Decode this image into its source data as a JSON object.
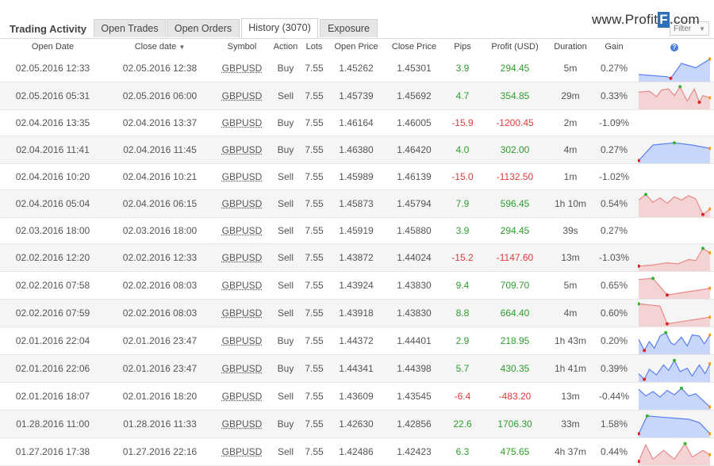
{
  "header": {
    "title": "Trading Activity",
    "tabs": [
      "Open Trades",
      "Open Orders",
      "History (3070)",
      "Exposure"
    ],
    "active_tab": 2,
    "brand_prefix": "www.Profit",
    "brand_f": "F",
    "brand_suffix": ".com",
    "filter_label": "Filter"
  },
  "colors": {
    "positive": "#2e9e2e",
    "negative": "#e23a3a",
    "spark_blue_fill": "#c9d6fb",
    "spark_blue_line": "#5a7ff0",
    "spark_red_fill": "#f3d3d3",
    "spark_red_line": "#e88a8a"
  },
  "columns": [
    "Open Date",
    "Close date",
    "Symbol",
    "Action",
    "Lots",
    "Open Price",
    "Close Price",
    "Pips",
    "Profit (USD)",
    "Duration",
    "Gain",
    "?"
  ],
  "rows": [
    {
      "open": "02.05.2016 12:33",
      "close": "02.05.2016 12:38",
      "symbol": "GBPUSD",
      "action": "Buy",
      "lots": "7.55",
      "open_price": "1.45262",
      "close_price": "1.45301",
      "pips": "3.9",
      "profit": "294.45",
      "duration": "5m",
      "gain": "0.27%",
      "pos": true,
      "spark": {
        "kind": "blue",
        "pts": [
          [
            0,
            0.25
          ],
          [
            0.4,
            0.15
          ],
          [
            0.45,
            0.08
          ],
          [
            0.6,
            0.75
          ],
          [
            0.8,
            0.55
          ],
          [
            1,
            0.95
          ]
        ]
      }
    },
    {
      "open": "02.05.2016 05:31",
      "close": "02.05.2016 06:00",
      "symbol": "GBPUSD",
      "action": "Sell",
      "lots": "7.55",
      "open_price": "1.45739",
      "close_price": "1.45692",
      "pips": "4.7",
      "profit": "354.85",
      "duration": "29m",
      "gain": "0.33%",
      "pos": true,
      "spark": {
        "kind": "red",
        "pts": [
          [
            0,
            0.7
          ],
          [
            0.15,
            0.75
          ],
          [
            0.25,
            0.5
          ],
          [
            0.32,
            0.8
          ],
          [
            0.42,
            0.85
          ],
          [
            0.5,
            0.55
          ],
          [
            0.58,
            0.95
          ],
          [
            0.68,
            0.3
          ],
          [
            0.78,
            0.85
          ],
          [
            0.85,
            0.25
          ],
          [
            0.9,
            0.55
          ],
          [
            1,
            0.45
          ]
        ]
      }
    },
    {
      "open": "02.04.2016 13:35",
      "close": "02.04.2016 13:37",
      "symbol": "GBPUSD",
      "action": "Buy",
      "lots": "7.55",
      "open_price": "1.46164",
      "close_price": "1.46005",
      "pips": "-15.9",
      "profit": "-1200.45",
      "duration": "2m",
      "gain": "-1.09%",
      "pos": false,
      "spark": null
    },
    {
      "open": "02.04.2016 11:41",
      "close": "02.04.2016 11:45",
      "symbol": "GBPUSD",
      "action": "Buy",
      "lots": "7.55",
      "open_price": "1.46380",
      "close_price": "1.46420",
      "pips": "4.0",
      "profit": "302.00",
      "duration": "4m",
      "gain": "0.27%",
      "pos": true,
      "spark": {
        "kind": "blue",
        "pts": [
          [
            0,
            0.05
          ],
          [
            0.2,
            0.75
          ],
          [
            0.5,
            0.85
          ],
          [
            0.75,
            0.75
          ],
          [
            1,
            0.6
          ]
        ]
      }
    },
    {
      "open": "02.04.2016 10:20",
      "close": "02.04.2016 10:21",
      "symbol": "GBPUSD",
      "action": "Sell",
      "lots": "7.55",
      "open_price": "1.45989",
      "close_price": "1.46139",
      "pips": "-15.0",
      "profit": "-1132.50",
      "duration": "1m",
      "gain": "-1.02%",
      "pos": false,
      "spark": null
    },
    {
      "open": "02.04.2016 05:04",
      "close": "02.04.2016 06:15",
      "symbol": "GBPUSD",
      "action": "Sell",
      "lots": "7.55",
      "open_price": "1.45873",
      "close_price": "1.45794",
      "pips": "7.9",
      "profit": "596.45",
      "duration": "1h 10m",
      "gain": "0.54%",
      "pos": true,
      "spark": {
        "kind": "red",
        "pts": [
          [
            0,
            0.7
          ],
          [
            0.1,
            0.95
          ],
          [
            0.2,
            0.6
          ],
          [
            0.3,
            0.8
          ],
          [
            0.4,
            0.55
          ],
          [
            0.5,
            0.85
          ],
          [
            0.6,
            0.7
          ],
          [
            0.7,
            0.9
          ],
          [
            0.8,
            0.75
          ],
          [
            0.9,
            0.05
          ],
          [
            1,
            0.3
          ]
        ]
      }
    },
    {
      "open": "02.03.2016 18:00",
      "close": "02.03.2016 18:00",
      "symbol": "GBPUSD",
      "action": "Sell",
      "lots": "7.55",
      "open_price": "1.45919",
      "close_price": "1.45880",
      "pips": "3.9",
      "profit": "294.45",
      "duration": "39s",
      "gain": "0.27%",
      "pos": true,
      "spark": null
    },
    {
      "open": "02.02.2016 12:20",
      "close": "02.02.2016 12:33",
      "symbol": "GBPUSD",
      "action": "Sell",
      "lots": "7.55",
      "open_price": "1.43872",
      "close_price": "1.44024",
      "pips": "-15.2",
      "profit": "-1147.60",
      "duration": "13m",
      "gain": "-1.03%",
      "pos": false,
      "spark": {
        "kind": "red",
        "pts": [
          [
            0,
            0.15
          ],
          [
            0.2,
            0.2
          ],
          [
            0.4,
            0.3
          ],
          [
            0.55,
            0.25
          ],
          [
            0.7,
            0.45
          ],
          [
            0.8,
            0.4
          ],
          [
            0.9,
            0.95
          ],
          [
            1,
            0.75
          ]
        ]
      }
    },
    {
      "open": "02.02.2016 07:58",
      "close": "02.02.2016 08:03",
      "symbol": "GBPUSD",
      "action": "Sell",
      "lots": "7.55",
      "open_price": "1.43924",
      "close_price": "1.43830",
      "pips": "9.4",
      "profit": "709.70",
      "duration": "5m",
      "gain": "0.65%",
      "pos": true,
      "spark": {
        "kind": "red",
        "pts": [
          [
            0,
            0.8
          ],
          [
            0.2,
            0.85
          ],
          [
            0.4,
            0.1
          ],
          [
            0.6,
            0.2
          ],
          [
            0.8,
            0.3
          ],
          [
            1,
            0.4
          ]
        ]
      }
    },
    {
      "open": "02.02.2016 07:59",
      "close": "02.02.2016 08:03",
      "symbol": "GBPUSD",
      "action": "Sell",
      "lots": "7.55",
      "open_price": "1.43918",
      "close_price": "1.43830",
      "pips": "8.8",
      "profit": "664.40",
      "duration": "4m",
      "gain": "0.60%",
      "pos": true,
      "spark": {
        "kind": "red",
        "pts": [
          [
            0,
            0.95
          ],
          [
            0.3,
            0.85
          ],
          [
            0.4,
            0.05
          ],
          [
            0.6,
            0.15
          ],
          [
            0.8,
            0.25
          ],
          [
            1,
            0.35
          ]
        ]
      }
    },
    {
      "open": "02.01.2016 22:04",
      "close": "02.01.2016 23:47",
      "symbol": "GBPUSD",
      "action": "Buy",
      "lots": "7.55",
      "open_price": "1.44372",
      "close_price": "1.44401",
      "pips": "2.9",
      "profit": "218.95",
      "duration": "1h 43m",
      "gain": "0.20%",
      "pos": true,
      "spark": {
        "kind": "blue",
        "pts": [
          [
            0,
            0.6
          ],
          [
            0.08,
            0.1
          ],
          [
            0.15,
            0.5
          ],
          [
            0.22,
            0.2
          ],
          [
            0.3,
            0.75
          ],
          [
            0.38,
            0.9
          ],
          [
            0.45,
            0.45
          ],
          [
            0.5,
            0.35
          ],
          [
            0.6,
            0.7
          ],
          [
            0.68,
            0.3
          ],
          [
            0.75,
            0.8
          ],
          [
            0.85,
            0.75
          ],
          [
            0.92,
            0.4
          ],
          [
            1,
            0.8
          ]
        ]
      }
    },
    {
      "open": "02.01.2016 22:06",
      "close": "02.01.2016 23:47",
      "symbol": "GBPUSD",
      "action": "Buy",
      "lots": "7.55",
      "open_price": "1.44341",
      "close_price": "1.44398",
      "pips": "5.7",
      "profit": "430.35",
      "duration": "1h 41m",
      "gain": "0.39%",
      "pos": true,
      "spark": {
        "kind": "blue",
        "pts": [
          [
            0,
            0.3
          ],
          [
            0.08,
            0.05
          ],
          [
            0.15,
            0.5
          ],
          [
            0.25,
            0.25
          ],
          [
            0.35,
            0.7
          ],
          [
            0.42,
            0.45
          ],
          [
            0.5,
            0.9
          ],
          [
            0.58,
            0.4
          ],
          [
            0.68,
            0.55
          ],
          [
            0.75,
            0.2
          ],
          [
            0.85,
            0.7
          ],
          [
            0.93,
            0.3
          ],
          [
            1,
            0.75
          ]
        ]
      }
    },
    {
      "open": "02.01.2016 18:07",
      "close": "02.01.2016 18:20",
      "symbol": "GBPUSD",
      "action": "Sell",
      "lots": "7.55",
      "open_price": "1.43609",
      "close_price": "1.43545",
      "pips": "-6.4",
      "profit": "-483.20",
      "duration": "13m",
      "gain": "-0.44%",
      "pos": false,
      "spark": {
        "kind": "blue",
        "pts": [
          [
            0,
            0.85
          ],
          [
            0.1,
            0.55
          ],
          [
            0.2,
            0.75
          ],
          [
            0.3,
            0.5
          ],
          [
            0.4,
            0.8
          ],
          [
            0.5,
            0.6
          ],
          [
            0.6,
            0.9
          ],
          [
            0.7,
            0.55
          ],
          [
            0.8,
            0.65
          ],
          [
            0.9,
            0.35
          ],
          [
            1,
            0.05
          ]
        ]
      }
    },
    {
      "open": "01.28.2016 11:00",
      "close": "01.28.2016 11:33",
      "symbol": "GBPUSD",
      "action": "Buy",
      "lots": "7.55",
      "open_price": "1.42630",
      "close_price": "1.42856",
      "pips": "22.6",
      "profit": "1706.30",
      "duration": "33m",
      "gain": "1.58%",
      "pos": true,
      "spark": {
        "kind": "blue",
        "pts": [
          [
            0,
            0.1
          ],
          [
            0.12,
            0.9
          ],
          [
            0.3,
            0.85
          ],
          [
            0.5,
            0.8
          ],
          [
            0.7,
            0.75
          ],
          [
            0.85,
            0.6
          ],
          [
            1,
            0.1
          ]
        ]
      }
    },
    {
      "open": "01.27.2016 17:38",
      "close": "01.27.2016 22:16",
      "symbol": "GBPUSD",
      "action": "Sell",
      "lots": "7.55",
      "open_price": "1.42486",
      "close_price": "1.42423",
      "pips": "6.3",
      "profit": "475.65",
      "duration": "4h 37m",
      "gain": "0.44%",
      "pos": true,
      "spark": {
        "kind": "red",
        "pts": [
          [
            0,
            0.1
          ],
          [
            0.1,
            0.85
          ],
          [
            0.2,
            0.2
          ],
          [
            0.35,
            0.6
          ],
          [
            0.5,
            0.2
          ],
          [
            0.65,
            0.9
          ],
          [
            0.75,
            0.3
          ],
          [
            0.9,
            0.6
          ],
          [
            1,
            0.4
          ]
        ]
      }
    }
  ]
}
